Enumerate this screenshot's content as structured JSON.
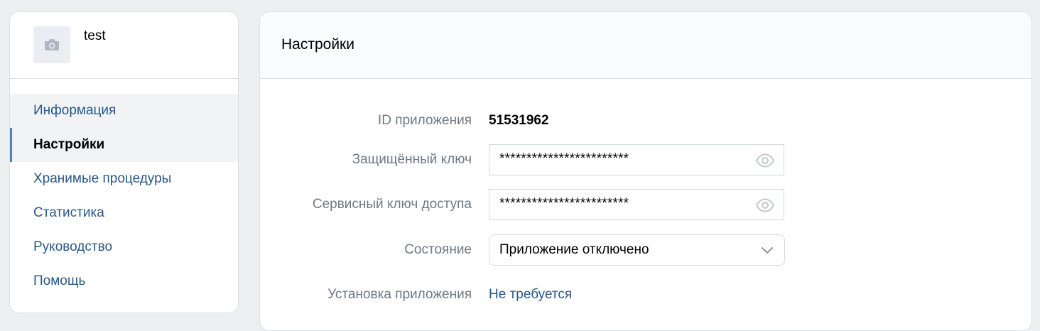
{
  "app": {
    "name": "test",
    "avatar_icon": "camera-icon"
  },
  "sidebar": {
    "items": [
      {
        "label": "Информация",
        "state": "hover"
      },
      {
        "label": "Настройки",
        "state": "active"
      },
      {
        "label": "Хранимые процедуры",
        "state": "normal"
      },
      {
        "label": "Статистика",
        "state": "normal"
      },
      {
        "label": "Руководство",
        "state": "normal"
      },
      {
        "label": "Помощь",
        "state": "normal"
      }
    ]
  },
  "main": {
    "title": "Настройки",
    "fields": {
      "app_id": {
        "label": "ID приложения",
        "value": "51531962"
      },
      "secure_key": {
        "label": "Защищённый ключ",
        "value": "************************",
        "icon": "eye-icon"
      },
      "service_key": {
        "label": "Сервисный ключ доступа",
        "value": "************************",
        "icon": "eye-icon"
      },
      "state": {
        "label": "Состояние",
        "value": "Приложение отключено",
        "icon": "chevron-down-icon"
      },
      "install": {
        "label": "Установка приложения",
        "value": "Не требуется"
      }
    }
  },
  "colors": {
    "link": "#2a5885",
    "label": "#6d7885",
    "active_indicator": "#5181b8",
    "background": "#edeef0",
    "border": "#dce1e6"
  }
}
